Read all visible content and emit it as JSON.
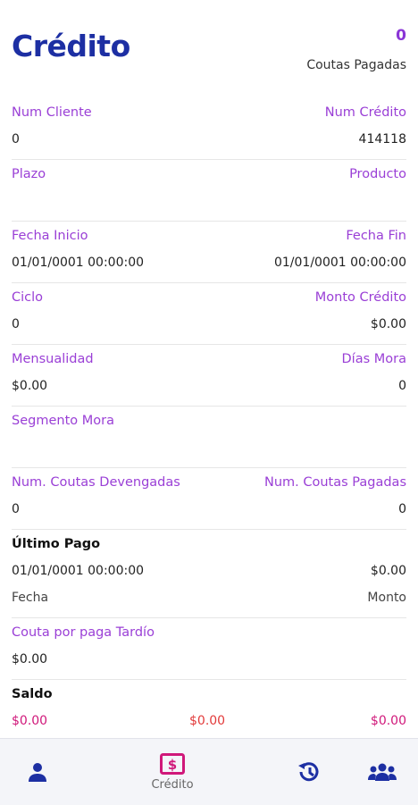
{
  "header": {
    "title": "Crédito",
    "paid_count": "0",
    "paid_label": "Coutas Pagadas"
  },
  "fields": {
    "num_cliente_label": "Num Cliente",
    "num_cliente": "0",
    "num_credito_label": "Num Crédito",
    "num_credito": "414118",
    "plazo_label": "Plazo",
    "producto_label": "Producto",
    "fecha_inicio_label": "Fecha Inicio",
    "fecha_inicio": "01/01/0001 00:00:00",
    "fecha_fin_label": "Fecha Fin",
    "fecha_fin": "01/01/0001 00:00:00",
    "ciclo_label": "Ciclo",
    "ciclo": "0",
    "monto_credito_label": "Monto Crédito",
    "monto_credito": "$0.00",
    "mensualidad_label": "Mensualidad",
    "mensualidad": "$0.00",
    "dias_mora_label": "Días Mora",
    "dias_mora": "0",
    "segmento_mora_label": "Segmento Mora",
    "devengadas_label": "Num. Coutas Devengadas",
    "devengadas": "0",
    "pagadas_label": "Num. Coutas Pagadas",
    "pagadas": "0"
  },
  "ultimo_pago": {
    "title": "Último Pago",
    "fecha": "01/01/0001 00:00:00",
    "monto": "$0.00",
    "fecha_label": "Fecha",
    "monto_label": "Monto"
  },
  "tardio": {
    "label": "Couta por paga Tardío",
    "value": "$0.00"
  },
  "saldo": {
    "title": "Saldo",
    "v1": "$0.00",
    "v2": "$0.00",
    "v3": "$0.00"
  },
  "nav": {
    "credito_label": "Crédito"
  },
  "colors": {
    "brand": "#1d2fa3",
    "label": "#9a3fd6",
    "active": "#d0187a",
    "red": "#e23a3a"
  }
}
